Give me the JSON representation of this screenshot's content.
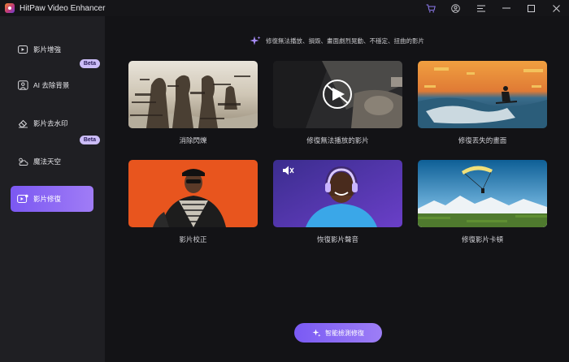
{
  "app": {
    "title": "HitPaw Video Enhancer"
  },
  "sidebar": {
    "items": [
      {
        "label": "影片增強",
        "icon": "video-enhance-icon",
        "active": false
      },
      {
        "label": "AI 去除背景",
        "icon": "ai-portrait-icon",
        "active": false,
        "badge": "Beta"
      },
      {
        "label": "影片去水印",
        "icon": "eraser-icon",
        "active": false
      },
      {
        "label": "魔法天空",
        "icon": "sky-icon",
        "active": false,
        "badge": "Beta"
      },
      {
        "label": "影片修復",
        "icon": "video-repair-icon",
        "active": true
      }
    ]
  },
  "main": {
    "hint": "修復無法播放、損毀、畫面劇烈晃動、不穩定、扭曲的影片",
    "cards": [
      {
        "label": "消除閃爍"
      },
      {
        "label": "修復無法播放的影片"
      },
      {
        "label": "修復丟失的畫面"
      },
      {
        "label": "影片校正"
      },
      {
        "label": "恢復影片聲音"
      },
      {
        "label": "修復影片卡頓"
      }
    ],
    "cta": "智能檢測修復"
  },
  "colors": {
    "accent": "#8a68f5",
    "sidebar_bg": "#1f1f23",
    "main_bg": "#131316"
  }
}
